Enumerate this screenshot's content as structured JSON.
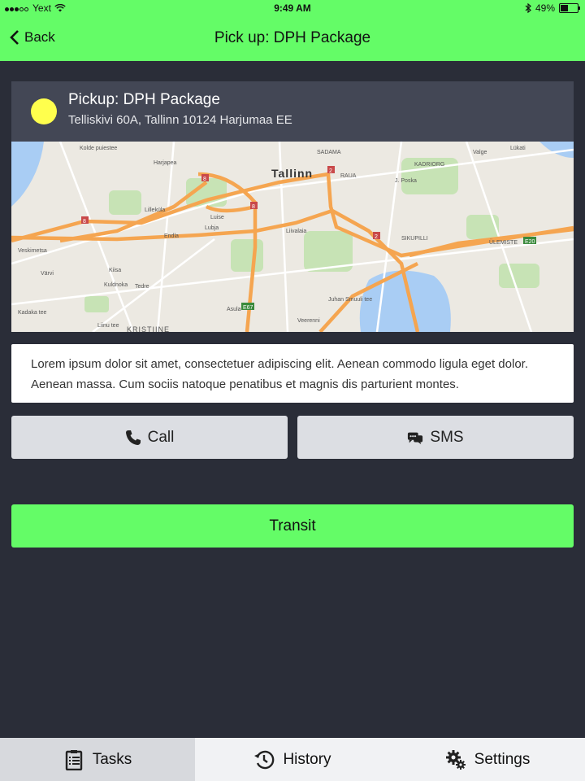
{
  "status_bar": {
    "carrier": "Yext",
    "time": "9:49 AM",
    "battery": "49%",
    "battery_level": 0.49
  },
  "nav": {
    "back_label": "Back",
    "title": "Pick up: DPH Package"
  },
  "pickup": {
    "title": "Pickup: DPH Package",
    "address": "Telliskivi 60A, Tallinn 10124 Harjumaa EE",
    "marker_color": "#ffff4d"
  },
  "map": {
    "labels": [
      "Tallinn",
      "Kolde puiestee",
      "Harjapea",
      "SADAMA",
      "RAUA",
      "KADRIORG",
      "Lilleküla",
      "Endla",
      "Luise",
      "Liivalaia",
      "SIKUPILLI",
      "ÜLEMISTE",
      "Veskimetsa",
      "Värvi",
      "Kristiine",
      "Kuldnoka",
      "Tedre",
      "Kiisa",
      "Kadaka tee",
      "Liinu tee",
      "Valge",
      "Lükati",
      "Juhan Smuuli tee",
      "Veerenni",
      "Asula",
      "Lubja",
      "J. Poska",
      "KRISTIINE"
    ],
    "route_badges": [
      "8",
      "8",
      "8",
      "8",
      "2",
      "2",
      "E67",
      "E20"
    ]
  },
  "description": "Lorem ipsum dolor sit amet, consectetuer adipiscing elit. Aenean commodo ligula eget dolor. Aenean massa. Cum sociis natoque penatibus et magnis dis parturient montes.",
  "actions": {
    "call_label": "Call",
    "sms_label": "SMS",
    "transit_label": "Transit"
  },
  "tabs": [
    {
      "label": "Tasks",
      "icon": "clipboard-icon",
      "active": true
    },
    {
      "label": "History",
      "icon": "clock-history-icon",
      "active": false
    },
    {
      "label": "Settings",
      "icon": "gears-icon",
      "active": false
    }
  ],
  "colors": {
    "accent": "#64fc67",
    "background": "#2a2d38",
    "card_header": "#434755",
    "button": "#dcdee3"
  }
}
